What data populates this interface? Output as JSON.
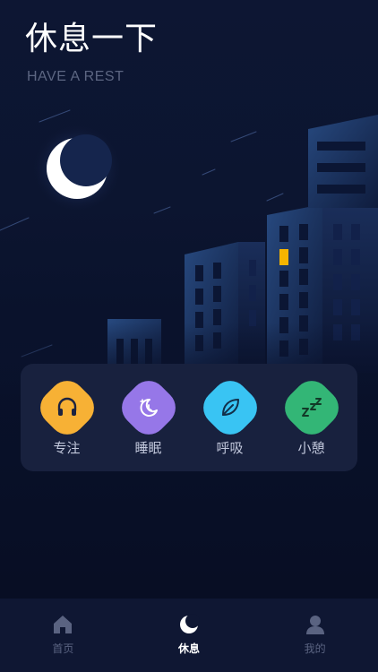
{
  "header": {
    "title": "休息一下",
    "subtitle": "HAVE A REST"
  },
  "modes": [
    {
      "label": "专注",
      "icon": "headphones-icon",
      "color": "#f7b135"
    },
    {
      "label": "睡眠",
      "icon": "moon-sleep-icon",
      "color": "#9677e8"
    },
    {
      "label": "呼吸",
      "icon": "leaf-icon",
      "color": "#39c4f3"
    },
    {
      "label": "小憩",
      "icon": "zzz-icon",
      "color": "#33b676"
    }
  ],
  "tabbar": {
    "tabs": [
      {
        "label": "首页",
        "icon": "home-icon",
        "active": false
      },
      {
        "label": "休息",
        "icon": "moon-icon",
        "active": true
      },
      {
        "label": "我的",
        "icon": "profile-icon",
        "active": false
      }
    ]
  },
  "colors": {
    "background": "#0b1430",
    "card": "#18213e",
    "tabbar": "#0f1733",
    "window_lit": "#f5b400"
  }
}
